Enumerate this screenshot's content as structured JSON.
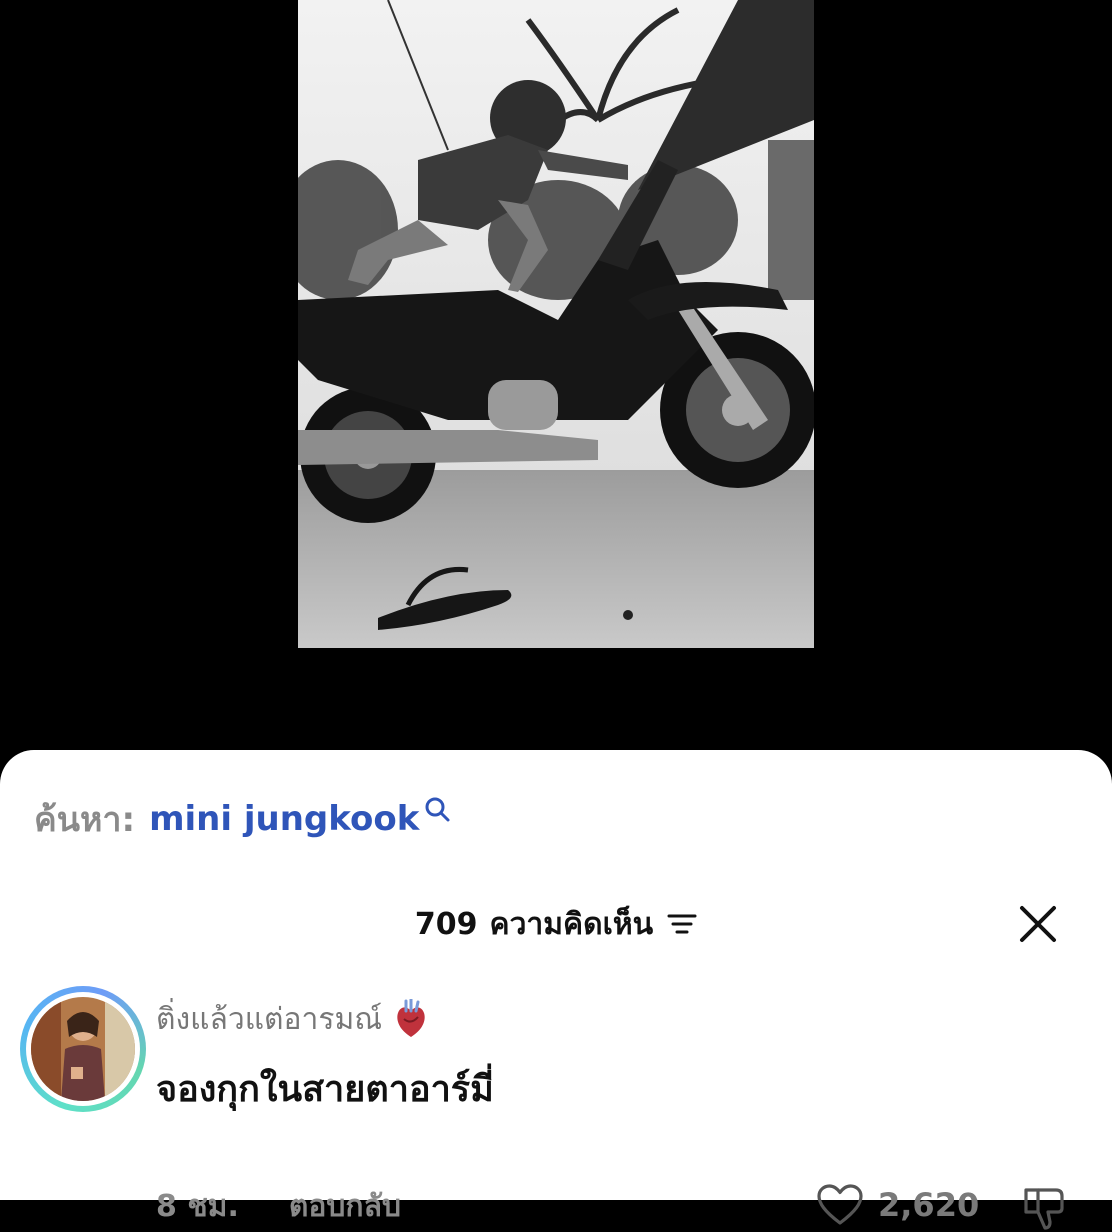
{
  "video": {
    "alt": "motorcycle-photo"
  },
  "search": {
    "prefix": "ค้นหา:",
    "query": "mini jungkook",
    "icon": "search-icon"
  },
  "comments_panel": {
    "count": "709",
    "count_label": "ความคิดเห็น",
    "sort_icon": "sort-icon",
    "close_icon": "close-icon"
  },
  "comment": {
    "username": "ติ่งแล้วแต่อารมณ์",
    "username_emoji": "anatomical-heart-emoji",
    "text": "จองกุกในสายตาอาร์มี่",
    "time": "8 ชม.",
    "reply_label": "ตอบกลับ",
    "likes": "2,620"
  },
  "colors": {
    "search_query": "#2f55b9",
    "muted": "#8a8a8a",
    "ring_a": "#5ee0c8",
    "ring_b": "#56b6f2"
  }
}
